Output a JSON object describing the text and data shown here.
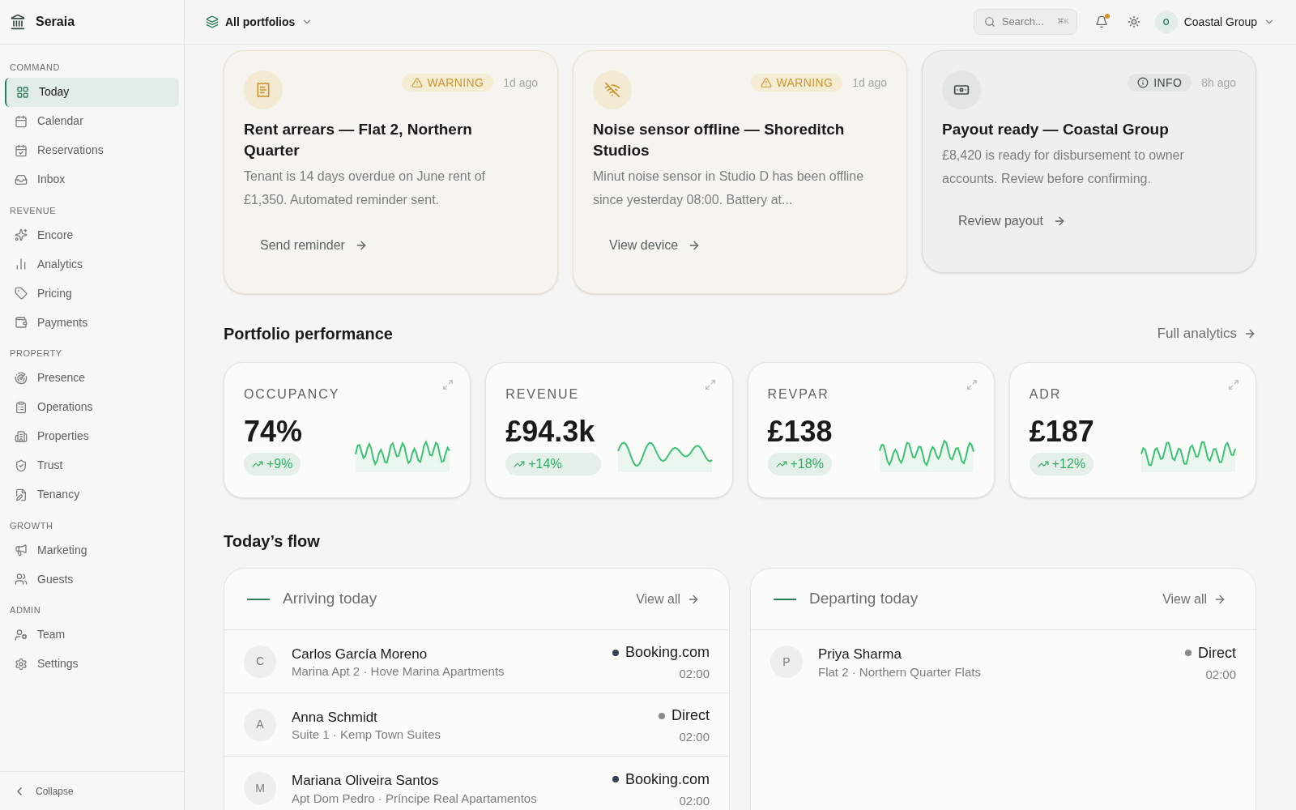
{
  "sidebar": {
    "brand": "Seraia",
    "sections": [
      {
        "title": "COMMAND",
        "items": [
          {
            "label": "Today",
            "selected": true
          },
          {
            "label": "Calendar",
            "selected": false
          },
          {
            "label": "Reservations",
            "selected": false
          },
          {
            "label": "Inbox",
            "selected": false
          }
        ]
      },
      {
        "title": "REVENUE",
        "items": [
          {
            "label": "Encore",
            "selected": false
          },
          {
            "label": "Analytics",
            "selected": false
          },
          {
            "label": "Pricing",
            "selected": false
          },
          {
            "label": "Payments",
            "selected": false
          }
        ]
      },
      {
        "title": "PROPERTY",
        "items": [
          {
            "label": "Presence",
            "selected": false
          },
          {
            "label": "Operations",
            "selected": false
          },
          {
            "label": "Properties",
            "selected": false
          },
          {
            "label": "Trust",
            "selected": false
          },
          {
            "label": "Tenancy",
            "selected": false
          }
        ]
      },
      {
        "title": "GROWTH",
        "items": [
          {
            "label": "Marketing",
            "selected": false
          },
          {
            "label": "Guests",
            "selected": false
          }
        ]
      },
      {
        "title": "ADMIN",
        "items": [
          {
            "label": "Team",
            "selected": false
          },
          {
            "label": "Settings",
            "selected": false
          }
        ]
      }
    ],
    "collapse": "Collapse"
  },
  "header": {
    "portfolio": "All portfolios",
    "search": {
      "placeholder": "Search...",
      "shortcut": "⌘K"
    },
    "notifications_unread": true,
    "account_initial": "O",
    "account": "Coastal Group"
  },
  "alerts": [
    {
      "kind": "warning",
      "badge": "WARNING",
      "time": "1d ago",
      "title": "Rent arrears — Flat 2, Northern Quarter",
      "body": "Tenant is 14 days overdue on June rent of £1,350. Automated reminder sent.",
      "action": "Send reminder"
    },
    {
      "kind": "warning",
      "badge": "WARNING",
      "time": "1d ago",
      "title": "Noise sensor offline — Shoreditch Studios",
      "body": "Minut noise sensor in Studio D has been offline since yesterday 08:00. Battery at...",
      "action": "View device"
    },
    {
      "kind": "info",
      "badge": "INFO",
      "time": "8h ago",
      "title": "Payout ready — Coastal Group",
      "body": "£8,420 is ready for disbursement to owner accounts. Review before confirming.",
      "action": "Review payout"
    }
  ],
  "performance": {
    "title": "Portfolio performance",
    "link": "Full analytics",
    "kpis": [
      {
        "label": "OCCUPANCY",
        "value": "74%",
        "change": "+9%"
      },
      {
        "label": "REVENUE",
        "value": "£94.3k",
        "change": "+14%"
      },
      {
        "label": "REVPAR",
        "value": "£138",
        "change": "+18%"
      },
      {
        "label": "ADR",
        "value": "£187",
        "change": "+12%"
      }
    ]
  },
  "flow": {
    "title": "Today’s flow",
    "panels": [
      {
        "title": "Arriving today",
        "link": "View all",
        "rows": [
          {
            "initial": "C",
            "name": "Carlos García Moreno",
            "detail": "Marina Apt 2 · Hove Marina Apartments",
            "channel": "Booking.com",
            "color": "#374151",
            "time": "02:00"
          },
          {
            "initial": "A",
            "name": "Anna Schmidt",
            "detail": "Suite 1 · Kemp Town Suites",
            "channel": "Direct",
            "color": "#8a8a8a",
            "time": "02:00"
          },
          {
            "initial": "M",
            "name": "Mariana Oliveira Santos",
            "detail": "Apt Dom Pedro · Príncipe Real Apartamentos",
            "channel": "Booking.com",
            "color": "#374151",
            "time": "02:00"
          }
        ]
      },
      {
        "title": "Departing today",
        "link": "View all",
        "rows": [
          {
            "initial": "P",
            "name": "Priya Sharma",
            "detail": "Flat 2 · Northern Quarter Flats",
            "channel": "Direct",
            "color": "#8a8a8a",
            "time": "02:00"
          }
        ]
      }
    ]
  }
}
